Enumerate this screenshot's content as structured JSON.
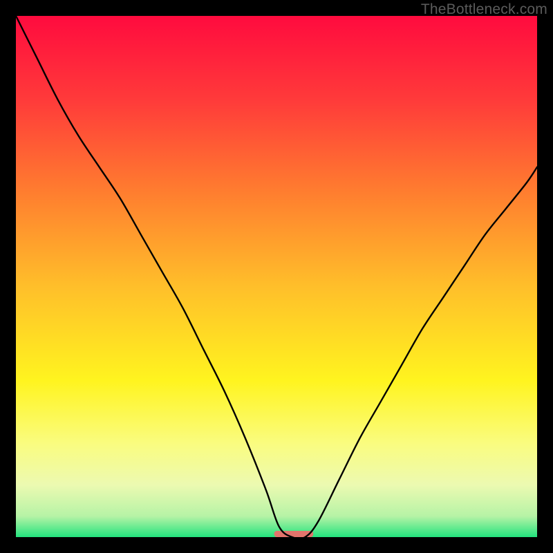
{
  "watermark": "TheBottleneck.com",
  "chart_data": {
    "type": "line",
    "title": "",
    "xlabel": "",
    "ylabel": "",
    "xlim": [
      0,
      100
    ],
    "ylim": [
      0,
      100
    ],
    "grid": false,
    "legend": false,
    "background_gradient_stops": [
      {
        "pos": 0.0,
        "color": "#ff0b3e"
      },
      {
        "pos": 0.16,
        "color": "#ff3a3a"
      },
      {
        "pos": 0.34,
        "color": "#ff7e2f"
      },
      {
        "pos": 0.52,
        "color": "#ffbf2a"
      },
      {
        "pos": 0.7,
        "color": "#fff41f"
      },
      {
        "pos": 0.82,
        "color": "#fafc7f"
      },
      {
        "pos": 0.9,
        "color": "#ecfab1"
      },
      {
        "pos": 0.96,
        "color": "#b6f3a6"
      },
      {
        "pos": 1.0,
        "color": "#23e37e"
      }
    ],
    "series": [
      {
        "name": "bottleneck-curve",
        "x": [
          0,
          4,
          8,
          12,
          16,
          20,
          24,
          28,
          32,
          36,
          40,
          44,
          48,
          50.5,
          53,
          55.5,
          58,
          62,
          66,
          70,
          74,
          78,
          82,
          86,
          90,
          94,
          98,
          100
        ],
        "y": [
          100,
          92,
          84,
          77,
          71,
          65,
          58,
          51,
          44,
          36,
          28,
          19,
          9,
          2,
          0,
          0,
          3,
          11,
          19,
          26,
          33,
          40,
          46,
          52,
          58,
          63,
          68,
          71
        ]
      }
    ],
    "marker": {
      "name": "optimal-range-marker",
      "x_center": 53.3,
      "y": 0,
      "width_x": 7.5,
      "color": "#e2746c"
    }
  }
}
